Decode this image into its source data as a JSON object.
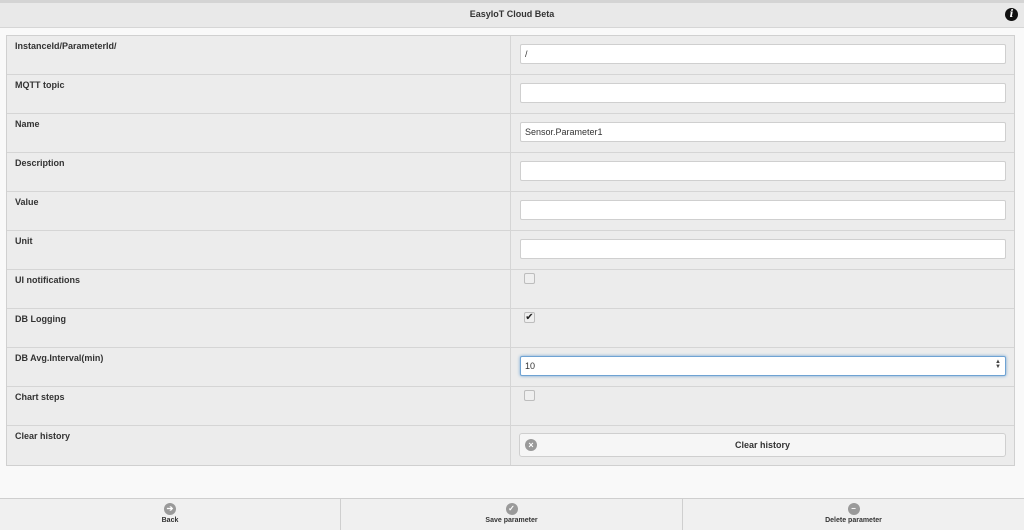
{
  "header": {
    "title": "EasyIoT Cloud Beta",
    "info_icon": "info-icon"
  },
  "form": {
    "instance": {
      "label": "InstanceId/ParameterId/",
      "value": "/"
    },
    "mqtt": {
      "label": "MQTT topic",
      "value": ""
    },
    "name": {
      "label": "Name",
      "value": "Sensor.Parameter1"
    },
    "description": {
      "label": "Description",
      "value": ""
    },
    "value": {
      "label": "Value",
      "value": ""
    },
    "unit": {
      "label": "Unit",
      "value": ""
    },
    "ui_notifications": {
      "label": "UI notifications",
      "checked": false
    },
    "db_logging": {
      "label": "DB Logging",
      "checked": true
    },
    "db_avg_interval": {
      "label": "DB Avg.Interval(min)",
      "value": "10"
    },
    "chart_steps": {
      "label": "Chart steps",
      "checked": false
    },
    "clear_history": {
      "label": "Clear history",
      "button_label": "Clear history",
      "icon": "x-circle-icon"
    }
  },
  "footer": {
    "back": {
      "label": "Back",
      "icon": "arrow-circle-icon"
    },
    "save": {
      "label": "Save parameter",
      "icon": "check-circle-icon"
    },
    "delete": {
      "label": "Delete parameter",
      "icon": "minus-circle-icon"
    }
  },
  "colors": {
    "focus_ring": "#6fa3d3",
    "row_bg": "#ececec",
    "header_bg": "#e9e9e9"
  }
}
